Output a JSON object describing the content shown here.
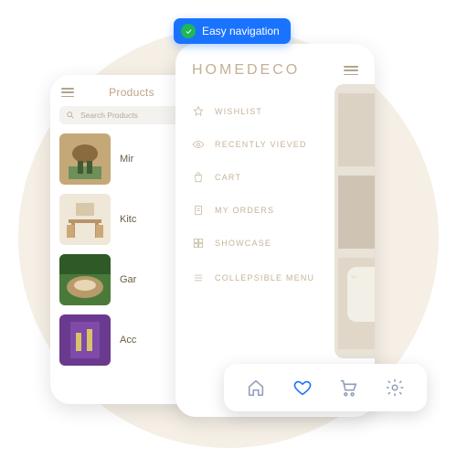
{
  "badge": {
    "text": "Easy navigation"
  },
  "back_phone": {
    "title": "Products",
    "search_placeholder": "Search Products",
    "rows": [
      {
        "label": "Mir"
      },
      {
        "label": "Kitc"
      },
      {
        "label": "Gar"
      },
      {
        "label": "Acc"
      }
    ]
  },
  "front_phone": {
    "brand": "HOMEDECO",
    "nav": [
      {
        "label": "WISHLIST"
      },
      {
        "label": "RECENTLY VIEVED"
      },
      {
        "label": "CART"
      },
      {
        "label": "MY ORDERS"
      },
      {
        "label": "SHOWCASE"
      },
      {
        "label": "COLLEPSIBLE MENU"
      }
    ]
  },
  "bottombar": {
    "home": "home-icon",
    "heart": "heart-icon",
    "cart": "cart-icon",
    "settings": "gear-icon"
  },
  "colors": {
    "accent": "#1a73ff",
    "brand_text": "#c4af96"
  }
}
